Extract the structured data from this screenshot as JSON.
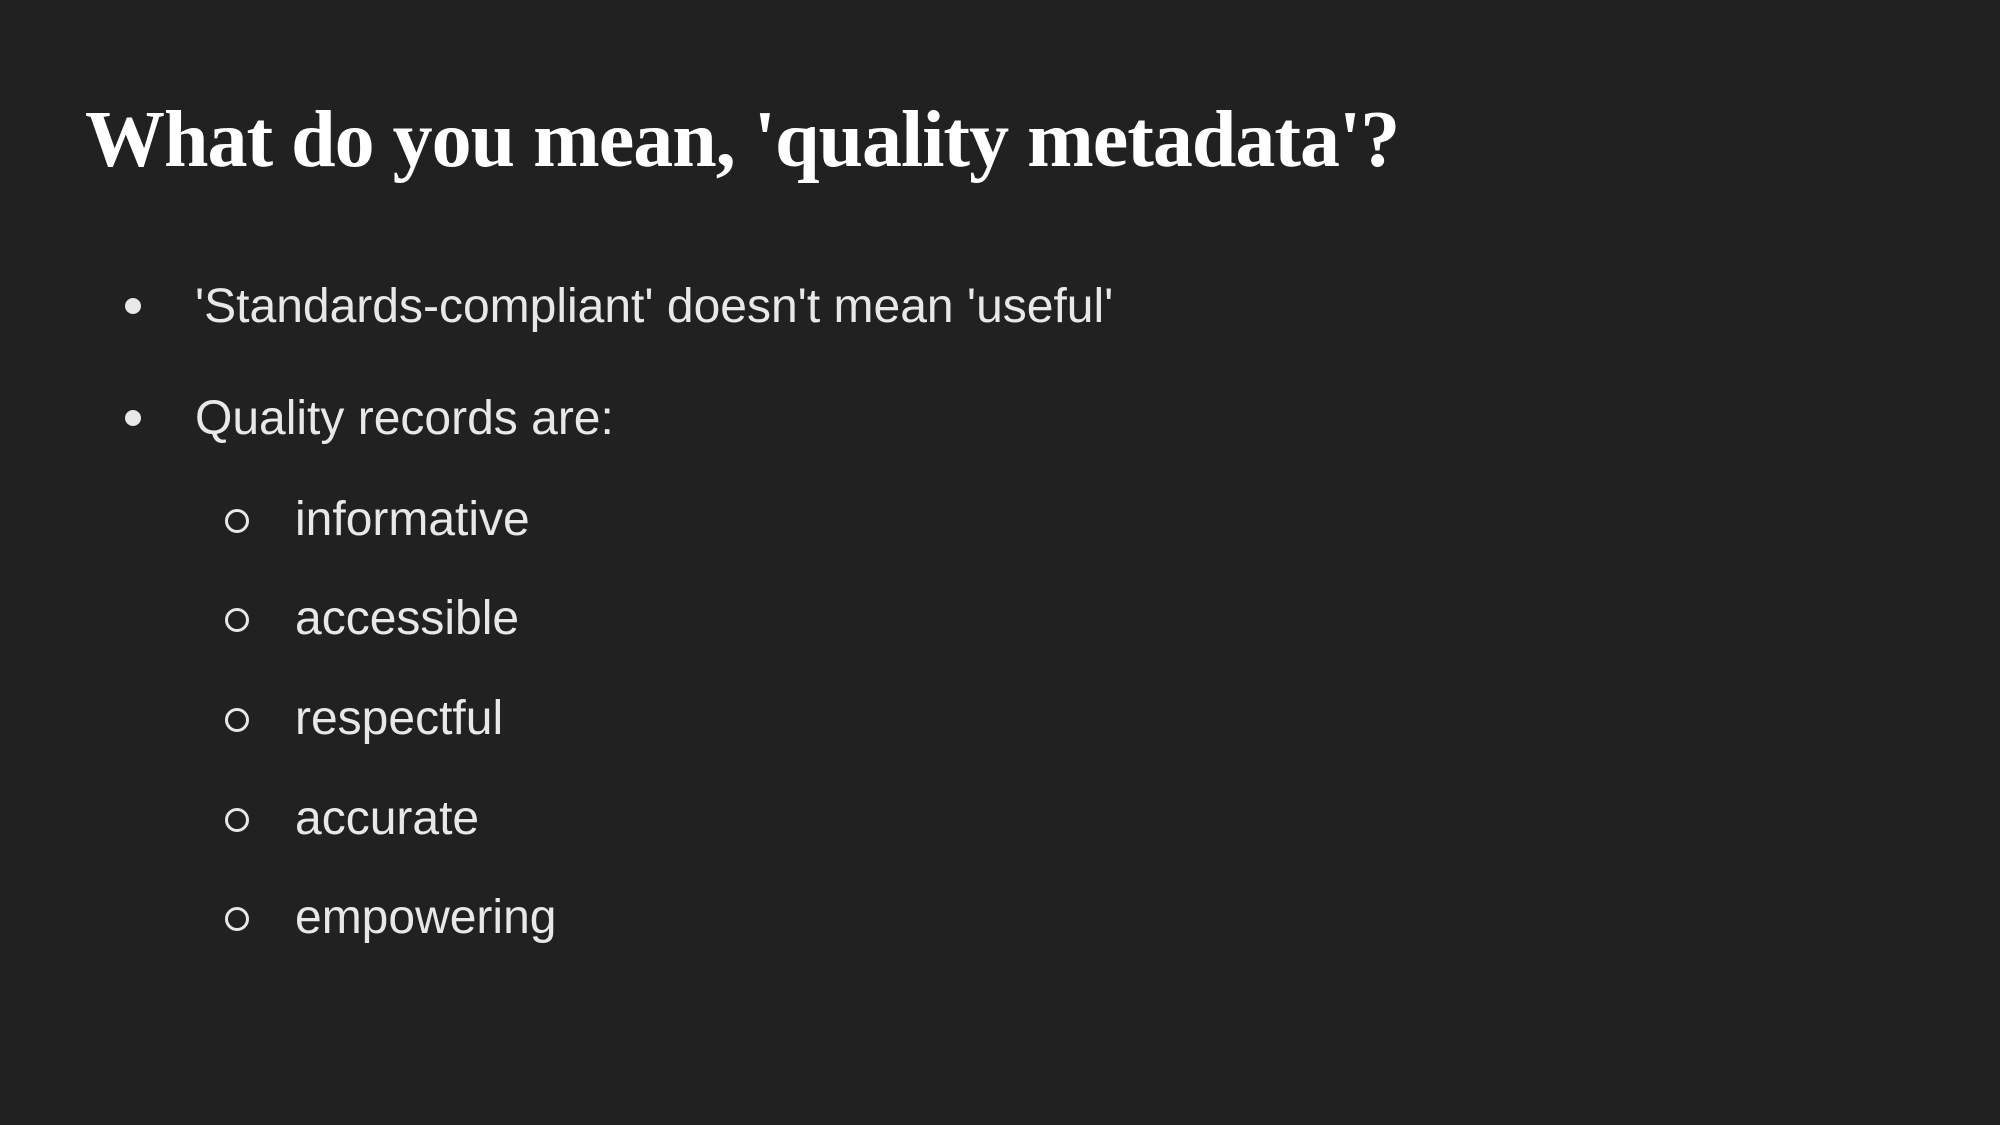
{
  "slide": {
    "title": "What do you mean, 'quality metadata'?",
    "bullets": [
      {
        "text": "'Standards-compliant' doesn't mean 'useful'"
      },
      {
        "text": "Quality records are:",
        "subitems": [
          "informative",
          "accessible",
          "respectful",
          "accurate",
          "empowering"
        ]
      }
    ]
  }
}
